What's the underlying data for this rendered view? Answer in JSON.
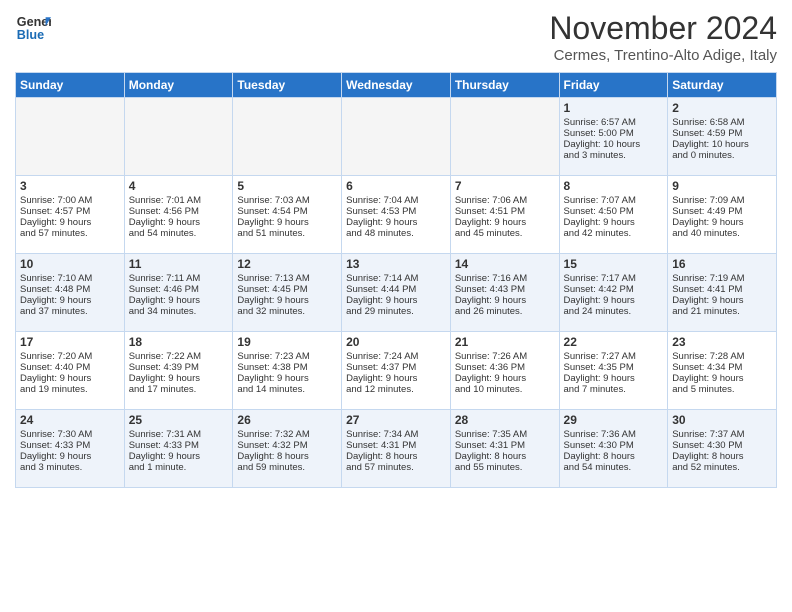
{
  "logo": {
    "line1": "General",
    "line2": "Blue"
  },
  "title": "November 2024",
  "subtitle": "Cermes, Trentino-Alto Adige, Italy",
  "days_of_week": [
    "Sunday",
    "Monday",
    "Tuesday",
    "Wednesday",
    "Thursday",
    "Friday",
    "Saturday"
  ],
  "weeks": [
    [
      {
        "day": "",
        "info": ""
      },
      {
        "day": "",
        "info": ""
      },
      {
        "day": "",
        "info": ""
      },
      {
        "day": "",
        "info": ""
      },
      {
        "day": "",
        "info": ""
      },
      {
        "day": "1",
        "info": "Sunrise: 6:57 AM\nSunset: 5:00 PM\nDaylight: 10 hours\nand 3 minutes."
      },
      {
        "day": "2",
        "info": "Sunrise: 6:58 AM\nSunset: 4:59 PM\nDaylight: 10 hours\nand 0 minutes."
      }
    ],
    [
      {
        "day": "3",
        "info": "Sunrise: 7:00 AM\nSunset: 4:57 PM\nDaylight: 9 hours\nand 57 minutes."
      },
      {
        "day": "4",
        "info": "Sunrise: 7:01 AM\nSunset: 4:56 PM\nDaylight: 9 hours\nand 54 minutes."
      },
      {
        "day": "5",
        "info": "Sunrise: 7:03 AM\nSunset: 4:54 PM\nDaylight: 9 hours\nand 51 minutes."
      },
      {
        "day": "6",
        "info": "Sunrise: 7:04 AM\nSunset: 4:53 PM\nDaylight: 9 hours\nand 48 minutes."
      },
      {
        "day": "7",
        "info": "Sunrise: 7:06 AM\nSunset: 4:51 PM\nDaylight: 9 hours\nand 45 minutes."
      },
      {
        "day": "8",
        "info": "Sunrise: 7:07 AM\nSunset: 4:50 PM\nDaylight: 9 hours\nand 42 minutes."
      },
      {
        "day": "9",
        "info": "Sunrise: 7:09 AM\nSunset: 4:49 PM\nDaylight: 9 hours\nand 40 minutes."
      }
    ],
    [
      {
        "day": "10",
        "info": "Sunrise: 7:10 AM\nSunset: 4:48 PM\nDaylight: 9 hours\nand 37 minutes."
      },
      {
        "day": "11",
        "info": "Sunrise: 7:11 AM\nSunset: 4:46 PM\nDaylight: 9 hours\nand 34 minutes."
      },
      {
        "day": "12",
        "info": "Sunrise: 7:13 AM\nSunset: 4:45 PM\nDaylight: 9 hours\nand 32 minutes."
      },
      {
        "day": "13",
        "info": "Sunrise: 7:14 AM\nSunset: 4:44 PM\nDaylight: 9 hours\nand 29 minutes."
      },
      {
        "day": "14",
        "info": "Sunrise: 7:16 AM\nSunset: 4:43 PM\nDaylight: 9 hours\nand 26 minutes."
      },
      {
        "day": "15",
        "info": "Sunrise: 7:17 AM\nSunset: 4:42 PM\nDaylight: 9 hours\nand 24 minutes."
      },
      {
        "day": "16",
        "info": "Sunrise: 7:19 AM\nSunset: 4:41 PM\nDaylight: 9 hours\nand 21 minutes."
      }
    ],
    [
      {
        "day": "17",
        "info": "Sunrise: 7:20 AM\nSunset: 4:40 PM\nDaylight: 9 hours\nand 19 minutes."
      },
      {
        "day": "18",
        "info": "Sunrise: 7:22 AM\nSunset: 4:39 PM\nDaylight: 9 hours\nand 17 minutes."
      },
      {
        "day": "19",
        "info": "Sunrise: 7:23 AM\nSunset: 4:38 PM\nDaylight: 9 hours\nand 14 minutes."
      },
      {
        "day": "20",
        "info": "Sunrise: 7:24 AM\nSunset: 4:37 PM\nDaylight: 9 hours\nand 12 minutes."
      },
      {
        "day": "21",
        "info": "Sunrise: 7:26 AM\nSunset: 4:36 PM\nDaylight: 9 hours\nand 10 minutes."
      },
      {
        "day": "22",
        "info": "Sunrise: 7:27 AM\nSunset: 4:35 PM\nDaylight: 9 hours\nand 7 minutes."
      },
      {
        "day": "23",
        "info": "Sunrise: 7:28 AM\nSunset: 4:34 PM\nDaylight: 9 hours\nand 5 minutes."
      }
    ],
    [
      {
        "day": "24",
        "info": "Sunrise: 7:30 AM\nSunset: 4:33 PM\nDaylight: 9 hours\nand 3 minutes."
      },
      {
        "day": "25",
        "info": "Sunrise: 7:31 AM\nSunset: 4:33 PM\nDaylight: 9 hours\nand 1 minute."
      },
      {
        "day": "26",
        "info": "Sunrise: 7:32 AM\nSunset: 4:32 PM\nDaylight: 8 hours\nand 59 minutes."
      },
      {
        "day": "27",
        "info": "Sunrise: 7:34 AM\nSunset: 4:31 PM\nDaylight: 8 hours\nand 57 minutes."
      },
      {
        "day": "28",
        "info": "Sunrise: 7:35 AM\nSunset: 4:31 PM\nDaylight: 8 hours\nand 55 minutes."
      },
      {
        "day": "29",
        "info": "Sunrise: 7:36 AM\nSunset: 4:30 PM\nDaylight: 8 hours\nand 54 minutes."
      },
      {
        "day": "30",
        "info": "Sunrise: 7:37 AM\nSunset: 4:30 PM\nDaylight: 8 hours\nand 52 minutes."
      }
    ]
  ]
}
